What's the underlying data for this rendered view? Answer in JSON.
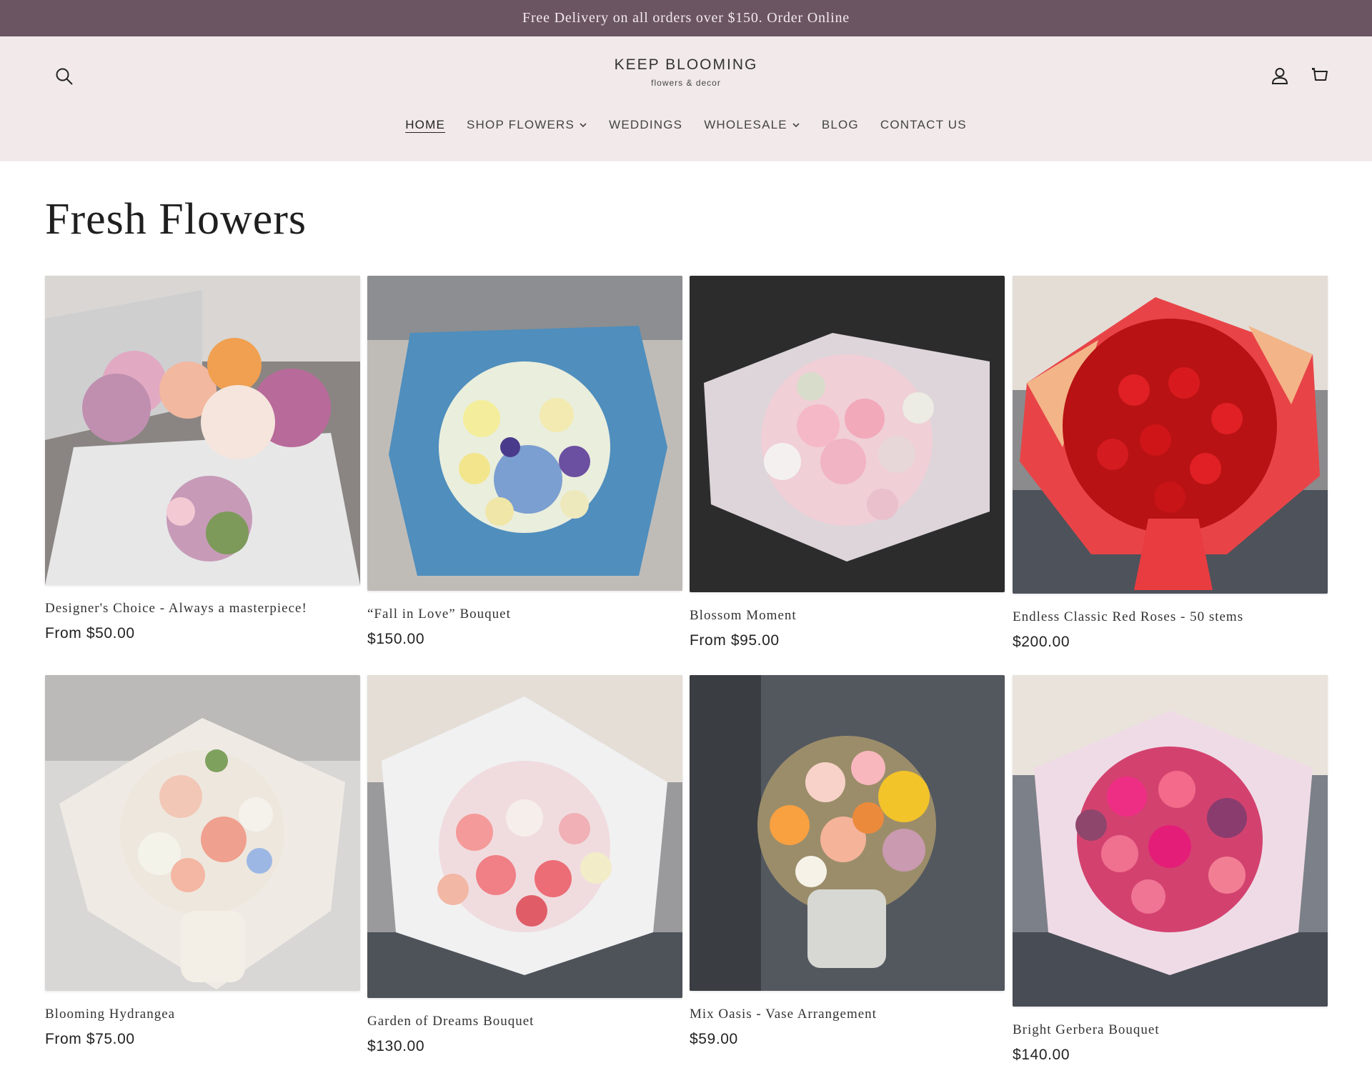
{
  "announcement": "Free Delivery on all orders over $150. Order Online",
  "header": {
    "logo_name": "KEEP BLOOMING",
    "logo_sub": "flowers & decor",
    "icons": {
      "search": "search-icon",
      "account": "user-icon",
      "cart": "cart-icon"
    }
  },
  "nav": [
    {
      "label": "HOME",
      "active": true
    },
    {
      "label": "SHOP FLOWERS",
      "dropdown": true
    },
    {
      "label": "WEDDINGS"
    },
    {
      "label": "WHOLESALE",
      "dropdown": true
    },
    {
      "label": "BLOG"
    },
    {
      "label": "CONTACT US"
    }
  ],
  "page_title": "Fresh Flowers",
  "products": [
    {
      "title": "Designer's Choice - Always a masterpiece!",
      "price": "From $50.00"
    },
    {
      "title": "“Fall in Love” Bouquet",
      "price": "$150.00"
    },
    {
      "title": "Blossom Moment",
      "price": "From $95.00"
    },
    {
      "title": "Endless Classic Red Roses - 50 stems",
      "price": "$200.00"
    },
    {
      "title": "Blooming Hydrangea",
      "price": "From $75.00"
    },
    {
      "title": "Garden of Dreams Bouquet",
      "price": "$130.00"
    },
    {
      "title": "Mix Oasis - Vase Arrangement",
      "price": "$59.00"
    },
    {
      "title": "Bright Gerbera Bouquet",
      "price": "$140.00"
    }
  ],
  "colors": {
    "announcement_bg": "#6b5562",
    "header_bg": "#f2eaea"
  }
}
